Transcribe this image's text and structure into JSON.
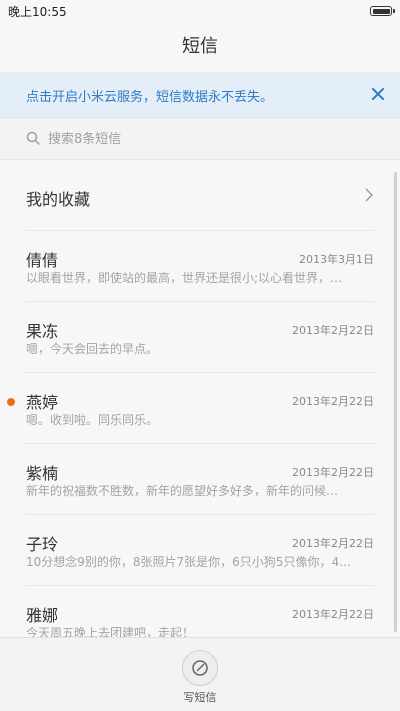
{
  "status_bar": {
    "time": "晚上10:55"
  },
  "header": {
    "title": "短信"
  },
  "cloud_banner": {
    "text": "点击开启小米云服务，短信数据永不丢失。"
  },
  "search": {
    "placeholder": "搜索8条短信"
  },
  "favorites": {
    "label": "我的收藏"
  },
  "messages": [
    {
      "name": "倩倩",
      "date": "2013年3月1日",
      "preview": "以眼看世界，即使站的最高，世界还是很小;以心看世界，…",
      "unread": false
    },
    {
      "name": "果冻",
      "date": "2013年2月22日",
      "preview": "嗯，今天会回去的早点。",
      "unread": false
    },
    {
      "name": "燕婷",
      "date": "2013年2月22日",
      "preview": "嗯。收到啦。同乐同乐。",
      "unread": true
    },
    {
      "name": "紫楠",
      "date": "2013年2月22日",
      "preview": "新年的祝福数不胜数，新年的愿望好多好多，新年的问候…",
      "unread": false
    },
    {
      "name": "子玲",
      "date": "2013年2月22日",
      "preview": "10分想念9别的你，8张照片7张是你，6只小狗5只像你，4…",
      "unread": false
    },
    {
      "name": "雅娜",
      "date": "2013年2月22日",
      "preview": "今天周五晚上去团建吧，走起！",
      "unread": false
    }
  ],
  "bottom": {
    "compose_label": "写短信"
  },
  "colors": {
    "accent_blue": "#2f7bc4",
    "unread_dot": "#f26b1d",
    "banner_bg": "#e3eef8"
  }
}
